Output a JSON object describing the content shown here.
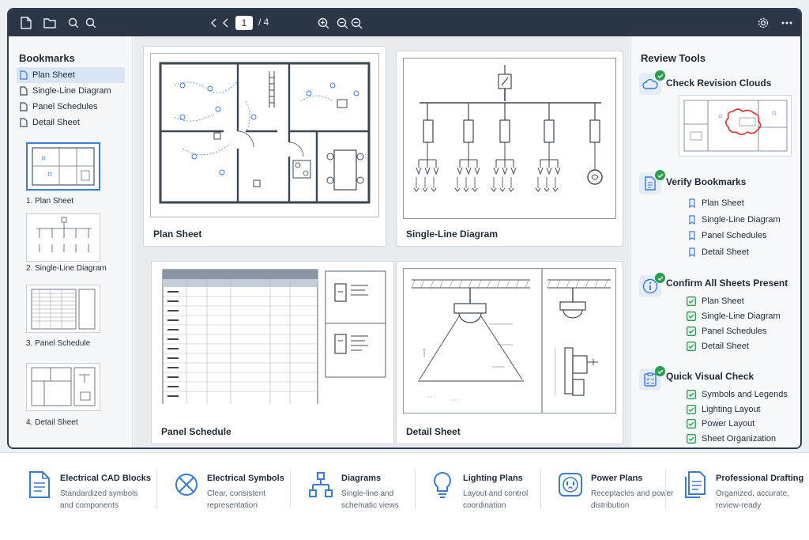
{
  "toolbar": {
    "page_current": "1",
    "page_total": "/ 4"
  },
  "bookmarks": {
    "title": "Bookmarks",
    "items": [
      {
        "label": "Plan Sheet",
        "active": true
      },
      {
        "label": "Single-Line Diagram"
      },
      {
        "label": "Panel Schedules"
      },
      {
        "label": "Detail Sheet"
      }
    ],
    "thumbnails": [
      "1. Plan Sheet",
      "2. Single-Line Diagram",
      "3. Panel Schedule",
      "4. Detail Sheet"
    ]
  },
  "sheets": [
    {
      "title": "Plan Sheet"
    },
    {
      "title": "Single-Line Diagram"
    },
    {
      "title": "Panel Schedule"
    },
    {
      "title": "Detail Sheet"
    }
  ],
  "review": {
    "title": "Review Tools",
    "sections": [
      {
        "title": "Check Revision Clouds",
        "icon": "cloud-icon"
      },
      {
        "title": "Verify Bookmarks",
        "icon": "document-icon",
        "items": [
          "Plan Sheet",
          "Single-Line Diagram",
          "Panel Schedules",
          "Detail Sheet"
        ]
      },
      {
        "title": "Confirm All Sheets Present",
        "icon": "info-icon",
        "items": [
          "Plan Sheet",
          "Single-Line Diagram",
          "Panel Schedules",
          "Detail Sheet"
        ]
      },
      {
        "title": "Quick Visual Check",
        "icon": "checklist-icon",
        "items": [
          "Symbols and Legends",
          "Lighting Layout",
          "Power Layout",
          "Sheet Organization"
        ]
      }
    ]
  },
  "features": [
    {
      "title": "Electrical CAD Blocks",
      "desc": "Standardized symbols and components",
      "icon": "document-icon"
    },
    {
      "title": "Electrical Symbols",
      "desc": "Clear, consistent representation",
      "icon": "circle-x-icon"
    },
    {
      "title": "Diagrams",
      "desc": "Single-line and schematic views",
      "icon": "hierarchy-icon"
    },
    {
      "title": "Lighting Plans",
      "desc": "Layout and control coordination",
      "icon": "lightbulb-icon"
    },
    {
      "title": "Power Plans",
      "desc": "Receptacles and power distribution",
      "icon": "outlet-icon"
    },
    {
      "title": "Professional Drafting",
      "desc": "Organized, accurate, review-ready",
      "icon": "documents-icon"
    }
  ],
  "colors": {
    "accent": "#3a7bd5",
    "toolbar": "#2b3646",
    "check": "#27a04a",
    "revision": "#e03030"
  }
}
